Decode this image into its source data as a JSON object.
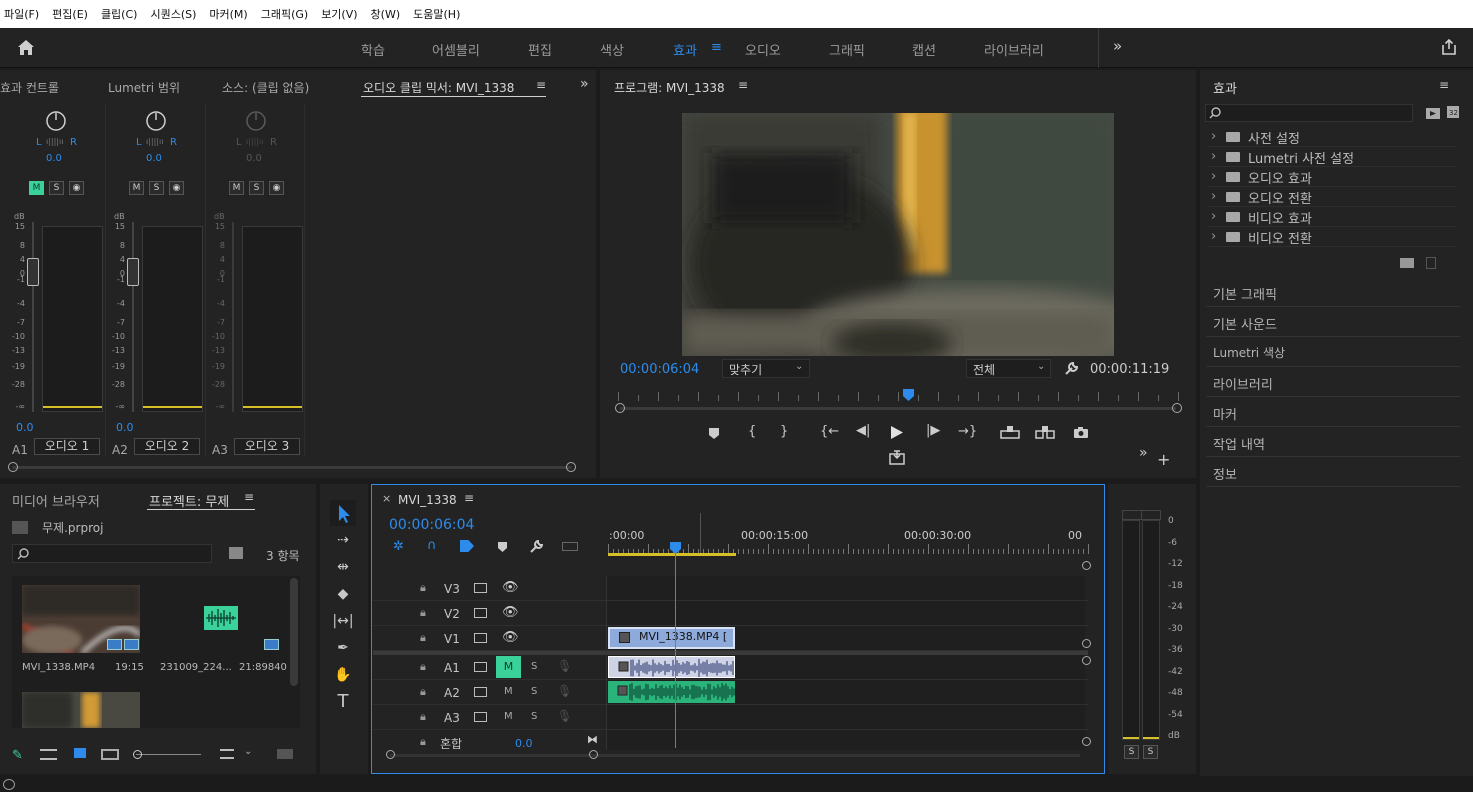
{
  "menu": [
    "파일(F)",
    "편집(E)",
    "클립(C)",
    "시퀀스(S)",
    "마커(M)",
    "그래픽(G)",
    "보기(V)",
    "창(W)",
    "도움말(H)"
  ],
  "workspaces": [
    "학습",
    "어셈블리",
    "편집",
    "색상",
    "효과",
    "오디오",
    "그래픽",
    "캡션",
    "라이브러리"
  ],
  "active_workspace": "효과",
  "more": "»",
  "left_tabs": [
    "효과 컨트롤",
    "Lumetri 범위",
    "소스: (클립 없음)",
    "오디오 클립 믹서: MVI_1338"
  ],
  "mixer": {
    "channels": [
      {
        "id": "A1",
        "name": "오디오 1",
        "l": "L",
        "r": "R",
        "pan": "0.0",
        "vol": "0.0",
        "m": "M",
        "s": "S",
        "muted": true
      },
      {
        "id": "A2",
        "name": "오디오 2",
        "l": "L",
        "r": "R",
        "pan": "0.0",
        "vol": "0.0",
        "m": "M",
        "s": "S",
        "muted": false
      },
      {
        "id": "A3",
        "name": "오디오 3",
        "l": "L",
        "r": "R",
        "pan": "0.0",
        "vol": "",
        "m": "M",
        "s": "S",
        "muted": false
      }
    ],
    "db_label": "dB",
    "scale": [
      "15",
      "8",
      "4",
      "0",
      "-1",
      "-4",
      "-7",
      "-10",
      "-13",
      "-19",
      "-28",
      "-∞"
    ]
  },
  "program": {
    "title": "프로그램: MVI_1338",
    "timecode": "00:00:06:04",
    "fit": "맞추기",
    "quality": "전체",
    "duration": "00:00:11:19"
  },
  "effects_panel": {
    "title": "효과",
    "search_placeholder": "",
    "items": [
      "사전 설정",
      "Lumetri 사전 설정",
      "오디오 효과",
      "오디오 전환",
      "비디오 효과",
      "비디오 전환"
    ],
    "sections": [
      "기본 그래픽",
      "기본 사운드",
      "Lumetri 색상",
      "라이브러리",
      "마커",
      "작업 내역",
      "정보"
    ]
  },
  "project": {
    "tabs": [
      "미디어 브라우저",
      "프로젝트: 무제"
    ],
    "file": "무제.prproj",
    "count": "3 항목",
    "items": [
      {
        "name": "MVI_1338.MP4",
        "dur": "19:15"
      },
      {
        "name": "231009_224...",
        "dur": "21:89840"
      }
    ]
  },
  "timeline": {
    "tab": "MVI_1338",
    "close": "×",
    "timecode": "00:00:06:04",
    "ruler": [
      ":00:00",
      "00:00:15:00",
      "00:00:30:00",
      "00"
    ],
    "tracks": [
      {
        "id": "V3"
      },
      {
        "id": "V2"
      },
      {
        "id": "V1"
      },
      {
        "id": "A1",
        "m": "M",
        "s": "S",
        "muted": true
      },
      {
        "id": "A2",
        "m": "M",
        "s": "S"
      },
      {
        "id": "A3",
        "m": "M",
        "s": "S"
      }
    ],
    "mix_label": "혼합",
    "mix_value": "0.0",
    "clip_name": "MVI_1338.MP4 ["
  },
  "audio_meter": {
    "scale": [
      "0",
      "-6",
      "-12",
      "-18",
      "-24",
      "-30",
      "-36",
      "-42",
      "-48",
      "-54",
      "dB"
    ],
    "s_left": "S",
    "s_right": "S"
  },
  "colors": {
    "accent": "#2d8ceb",
    "mute_on": "#3ad19b",
    "playhead": "#2d8ceb",
    "video_clip": "#8eaadb",
    "audio_clip": "#2bb37c",
    "yellow": "#d5c02a"
  }
}
